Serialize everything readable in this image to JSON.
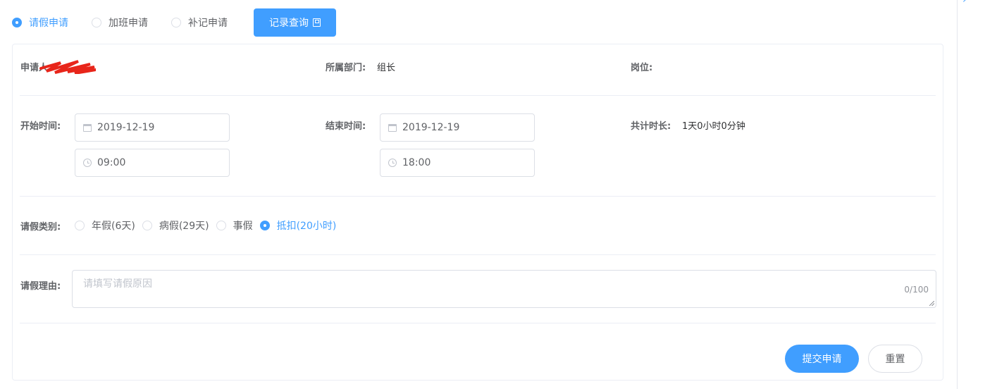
{
  "modes": [
    {
      "label": "请假申请",
      "selected": true
    },
    {
      "label": "加班申请",
      "selected": false
    },
    {
      "label": "补记申请",
      "selected": false
    }
  ],
  "query_button": {
    "label": "记录查询",
    "icon": "save-icon"
  },
  "applicant": {
    "label": "申请人:"
  },
  "department": {
    "label": "所属部门:",
    "value": "组长"
  },
  "position": {
    "label": "岗位:",
    "value": ""
  },
  "start": {
    "label": "开始时间:",
    "date": "2019-12-19",
    "time": "09:00"
  },
  "end": {
    "label": "结束时间:",
    "date": "2019-12-19",
    "time": "18:00"
  },
  "duration": {
    "label": "共计时长:",
    "value": "1天0小时0分钟"
  },
  "leave_type": {
    "label": "请假类别:",
    "options": [
      {
        "label": "年假(6天)",
        "selected": false
      },
      {
        "label": "病假(29天)",
        "selected": false
      },
      {
        "label": "事假",
        "selected": false
      },
      {
        "label": "抵扣(20小时)",
        "selected": true
      }
    ]
  },
  "reason": {
    "label": "请假理由:",
    "placeholder": "请填写请假原因",
    "counter": "0/100"
  },
  "actions": {
    "submit_label": "提交申请",
    "reset_label": "重置"
  },
  "colors": {
    "accent": "#409eff",
    "border": "#dcdfe6",
    "text": "#606266",
    "redaction": "#e8251a"
  }
}
